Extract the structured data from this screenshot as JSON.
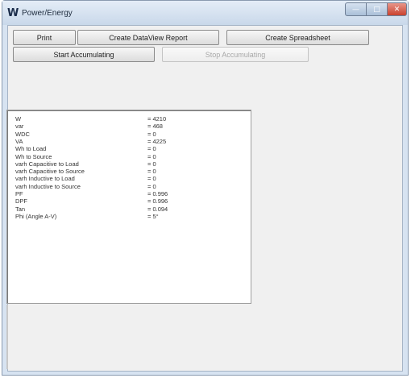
{
  "window": {
    "icon_glyph": "W",
    "title": "Power/Energy",
    "controls": {
      "minimize": "—",
      "maximize": "□",
      "close": "✕"
    }
  },
  "toolbar": {
    "print": "Print",
    "create_dataview_report": "Create DataView Report",
    "create_spreadsheet": "Create Spreadsheet",
    "start_accumulating": "Start Accumulating",
    "stop_accumulating": "Stop Accumulating"
  },
  "readings": [
    {
      "label": "W",
      "value": "= 4210"
    },
    {
      "label": "var",
      "value": "= 468"
    },
    {
      "label": "WDC",
      "value": "= 0"
    },
    {
      "label": "VA",
      "value": "= 4225"
    },
    {
      "label": "Wh to Load",
      "value": "= 0"
    },
    {
      "label": "Wh to Source",
      "value": "= 0"
    },
    {
      "label": "varh Capacitive to Load",
      "value": "= 0"
    },
    {
      "label": "varh Capacitive to Source",
      "value": "= 0"
    },
    {
      "label": "varh Inductive to Load",
      "value": "= 0"
    },
    {
      "label": "varh Inductive to Source",
      "value": "= 0"
    },
    {
      "label": "PF",
      "value": "= 0.996"
    },
    {
      "label": "DPF",
      "value": "= 0.996"
    },
    {
      "label": "Tan",
      "value": "= 0.094"
    },
    {
      "label": "Phi (Angle A-V)",
      "value": "= 5°"
    }
  ]
}
